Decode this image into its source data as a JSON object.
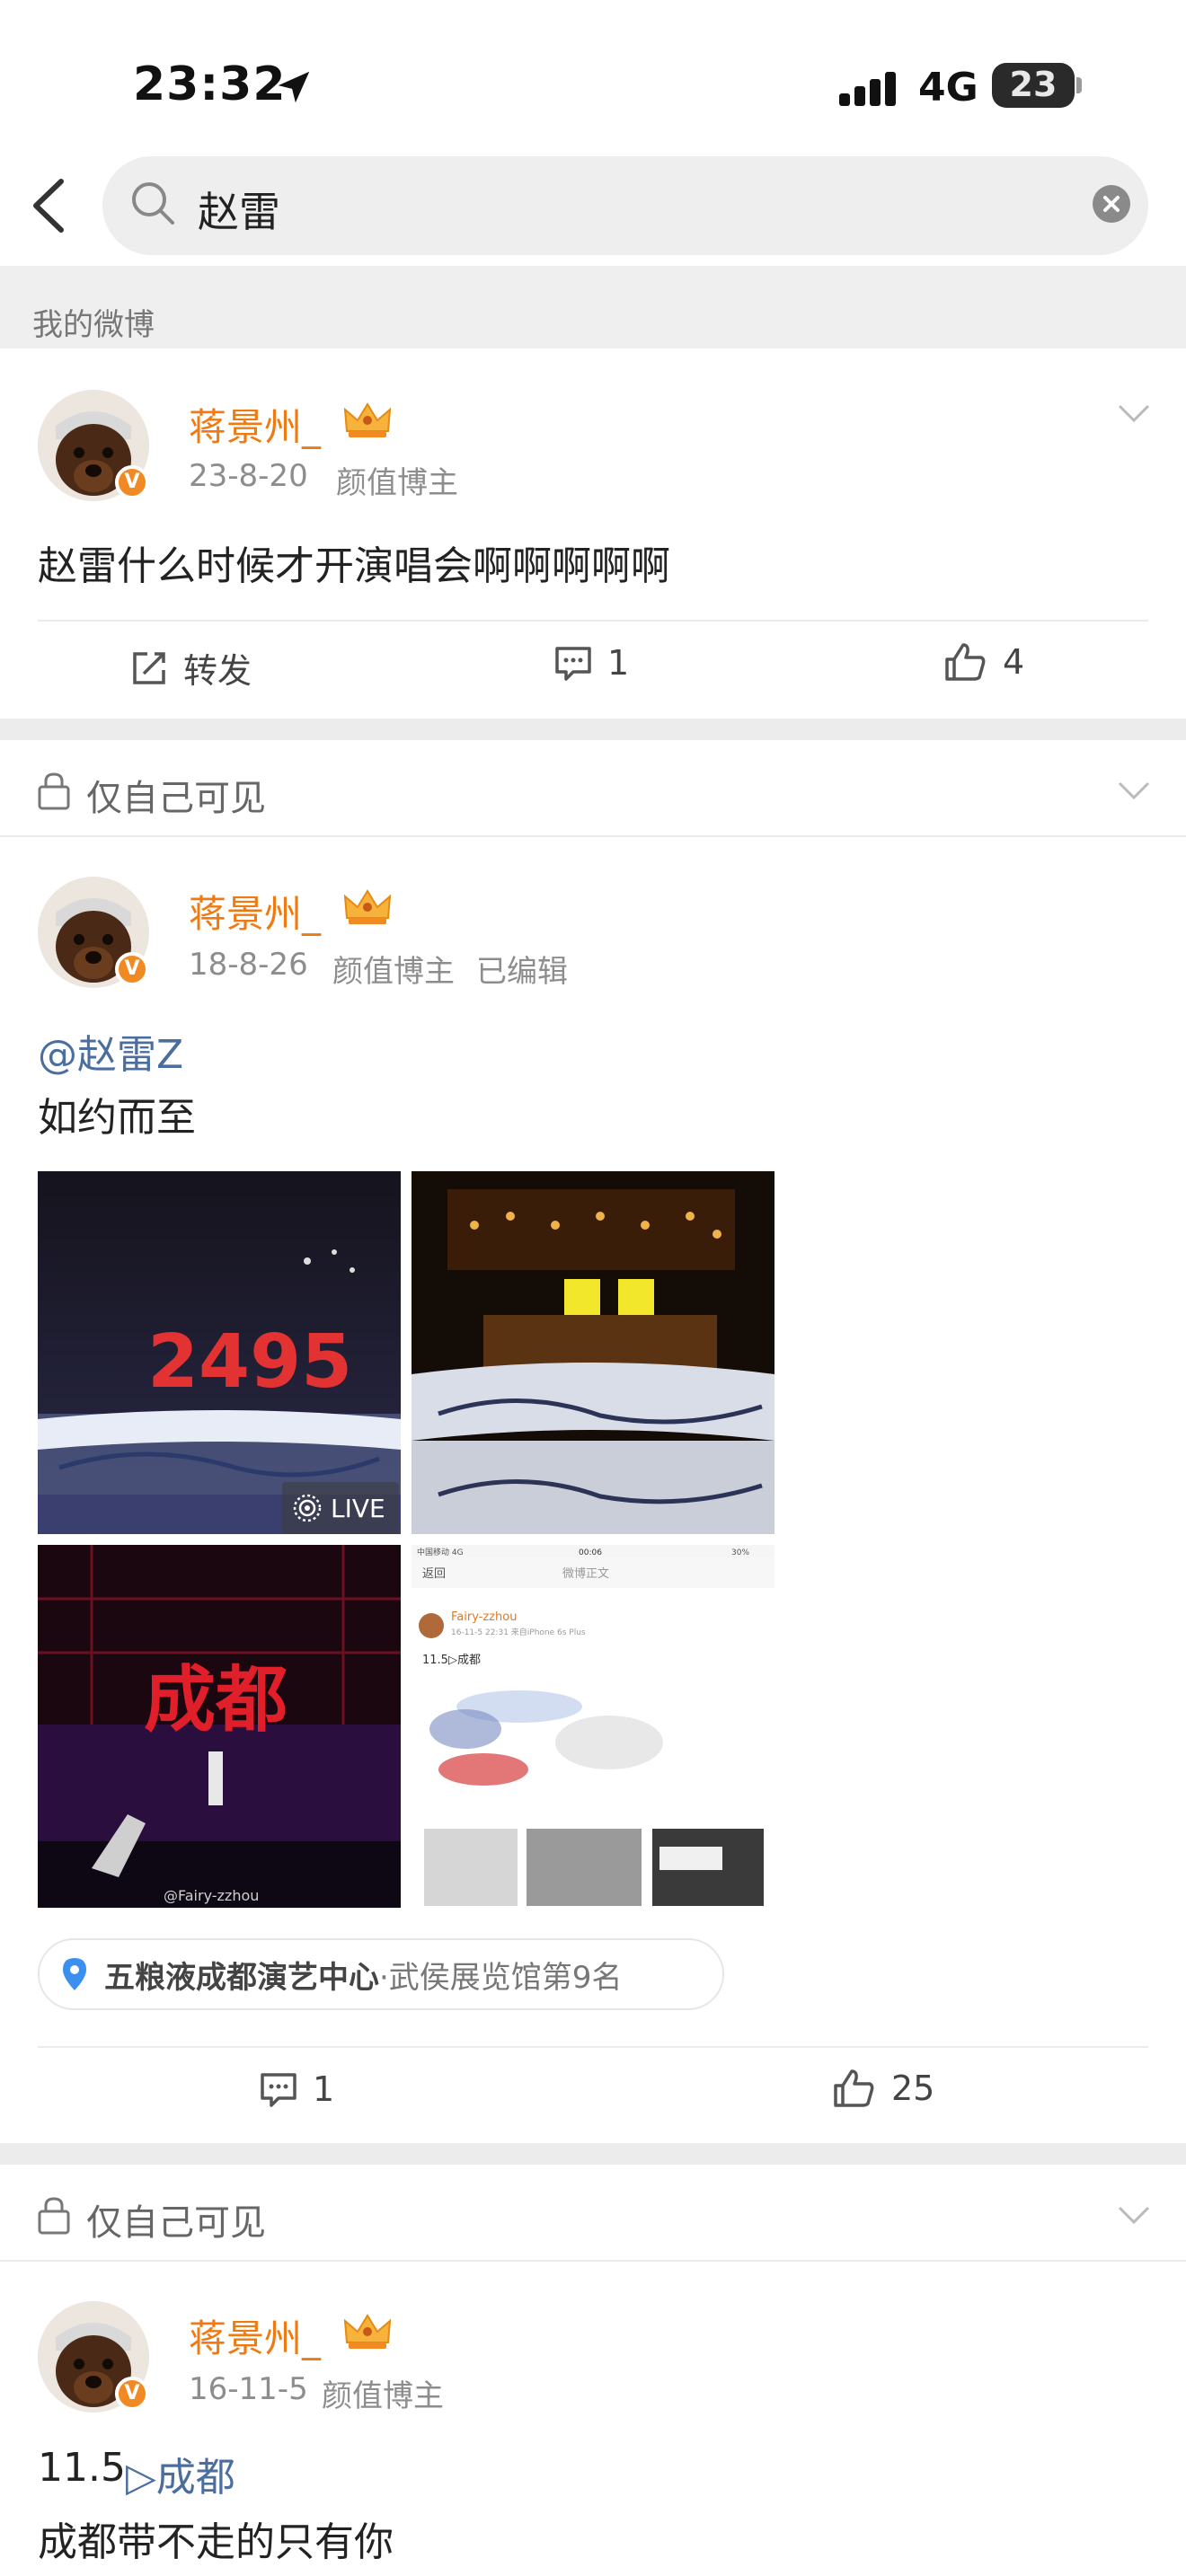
{
  "status_bar": {
    "time": "23:32",
    "network": "4G",
    "battery": "23"
  },
  "search": {
    "query": "赵雷"
  },
  "section": {
    "title": "我的微博"
  },
  "posts": [
    {
      "username": "蒋景州_",
      "date": "23-8-20",
      "tag": "颜值博主",
      "text": "赵雷什么时候才开演唱会啊啊啊啊啊",
      "actions": {
        "repost": "转发",
        "comments": "1",
        "likes": "4"
      }
    },
    {
      "visibility": "仅自己可见",
      "username": "蒋景州_",
      "date": "18-8-26",
      "tag": "颜值博主",
      "edited": "已编辑",
      "mention": "@赵雷Z",
      "text": "如约而至",
      "photos": [
        {
          "name": "concert-2495",
          "caption": "2495",
          "badge": "LIVE"
        },
        {
          "name": "concert-stage",
          "caption": ""
        },
        {
          "name": "concert-chengdu",
          "caption": "成都",
          "watermark": "@Fairy-zzhou"
        },
        {
          "name": "screenshot",
          "status_carrier": "中国移动 4G",
          "status_time": "00:06",
          "status_battery": "30%",
          "nav_back": "返回",
          "nav_title": "微博正文",
          "user": "Fairy-zzhou",
          "meta": "16-11-5 22:31 来自iPhone 6s Plus",
          "text": "11.5▷成都"
        }
      ],
      "location": {
        "name": "五粮液成都演艺中心",
        "sub": "·武侯展览馆第9名"
      },
      "actions": {
        "comments": "1",
        "likes": "25"
      }
    },
    {
      "visibility": "仅自己可见",
      "username": "蒋景州_",
      "date": "16-11-5",
      "tag": "颜值博主",
      "line1_prefix": "11.5",
      "line1_link": "▷成都",
      "text": "成都带不走的只有你"
    }
  ],
  "colors": {
    "username": "#f07a12",
    "link": "#4b6e9e",
    "verified": "#f28a23",
    "location_pin": "#3a8ff0"
  }
}
